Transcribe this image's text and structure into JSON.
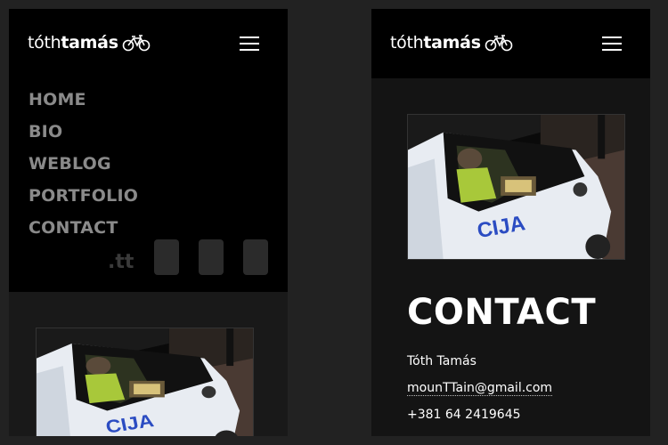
{
  "site": {
    "logo_light": "tóth",
    "logo_bold": "tamás",
    "bike_icon": "bicycle-icon",
    "menu_icon": "hamburger-menu-icon"
  },
  "left_phone": {
    "menu": {
      "items": [
        {
          "label": "HOME"
        },
        {
          "label": "BIO"
        },
        {
          "label": "WEBLOG"
        },
        {
          "label": "PORTFOLIO"
        },
        {
          "label": "CONTACT"
        }
      ],
      "tt_mark": ".tt"
    },
    "photo": {
      "icon": "police-car-photo"
    }
  },
  "right_phone": {
    "photo": {
      "icon": "police-car-photo"
    },
    "contact": {
      "title": "CONTACT",
      "name": "Tóth Tamás",
      "email": "mounTTain@gmail.com",
      "phone": "+381 64 2419645"
    }
  },
  "colors": {
    "page_background": "#222222",
    "header_background": "#000000",
    "menu_text": "#8a8a8a",
    "text": "#ffffff"
  }
}
